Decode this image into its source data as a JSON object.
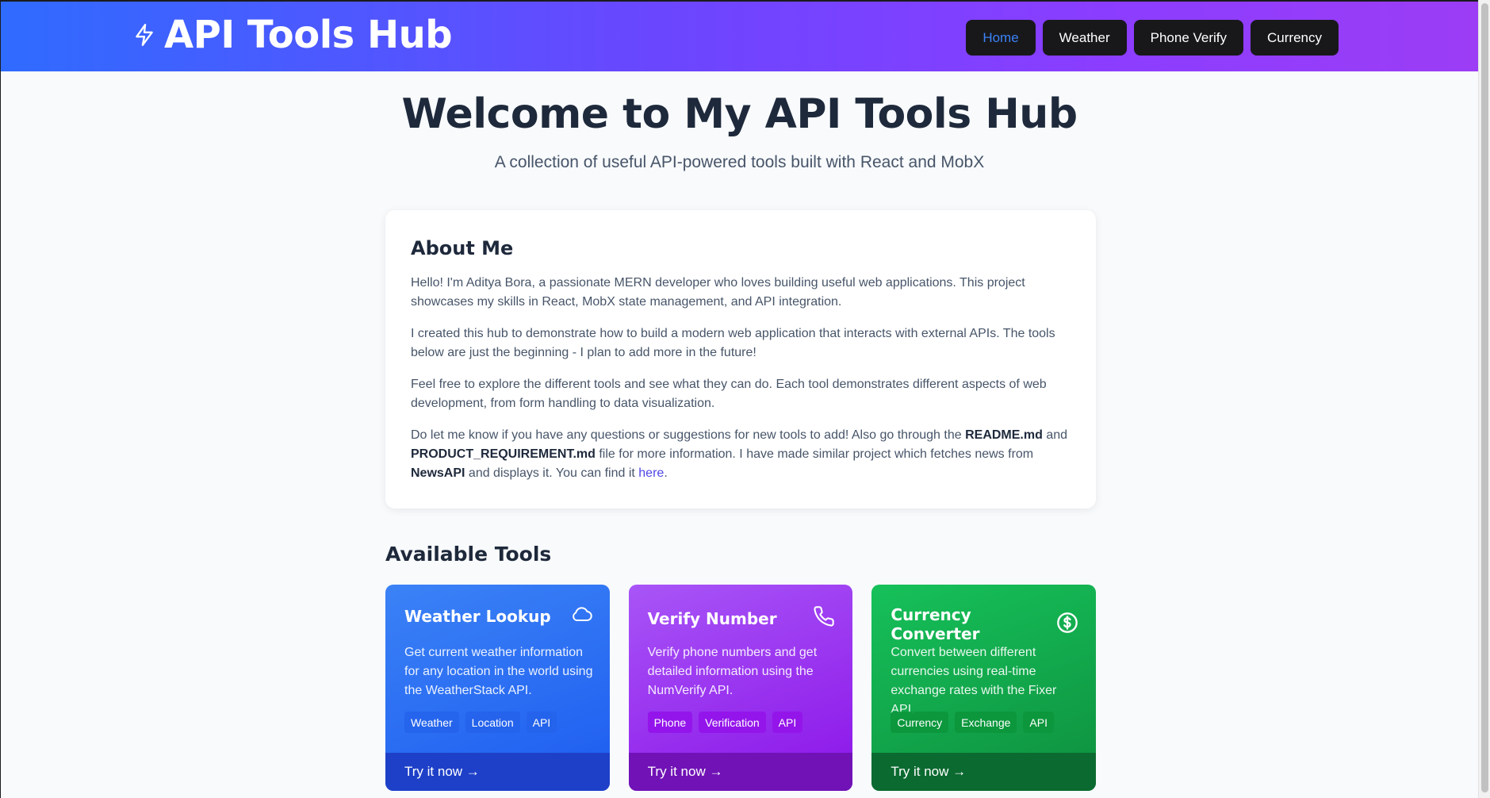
{
  "header": {
    "brand_title": "API Tools Hub",
    "brand_icon": "lightning-bolt-icon",
    "nav": [
      {
        "label": "Home",
        "active": true
      },
      {
        "label": "Weather",
        "active": false
      },
      {
        "label": "Phone Verify",
        "active": false
      },
      {
        "label": "Currency",
        "active": false
      }
    ],
    "gradient_colors": [
      "#2f6bff",
      "#9c3df5"
    ]
  },
  "hero": {
    "title": "Welcome to My API Tools Hub",
    "subtitle": "A collection of useful API-powered tools built with React and MobX"
  },
  "about": {
    "title": "About Me",
    "p1": "Hello! I'm Aditya Bora, a passionate MERN developer who loves building useful web applications. This project showcases my skills in React, MobX state management, and API integration.",
    "p2": "I created this hub to demonstrate how to build a modern web application that interacts with external APIs. The tools below are just the beginning - I plan to add more in the future!",
    "p3": "Feel free to explore the different tools and see what they can do. Each tool demonstrates different aspects of web development, from form handling to data visualization.",
    "p4": {
      "t1": "Do let me know if you have any questions or suggestions for new tools to add! Also go through the ",
      "b1": "README.md",
      "t2": " and ",
      "b2": "PRODUCT_REQUIREMENT.md",
      "t3": " file for more information. I have made similar project which fetches news from ",
      "b3": "NewsAPI",
      "t4": " and displays it. You can find it ",
      "link": "here",
      "t5": "."
    }
  },
  "tools_section": {
    "title": "Available Tools",
    "cards": [
      {
        "title": "Weather Lookup",
        "icon": "cloud-icon",
        "description": "Get current weather information for any location in the world using the WeatherStack API.",
        "tags": [
          "Weather",
          "Location",
          "API"
        ],
        "cta": "Try it now →",
        "color": "#2563eb"
      },
      {
        "title": "Verify Number",
        "icon": "phone-icon",
        "description": "Verify phone numbers and get detailed information using the NumVerify API.",
        "tags": [
          "Phone",
          "Verification",
          "API"
        ],
        "cta": "Try it now →",
        "color": "#9333ea"
      },
      {
        "title": "Currency Converter",
        "icon": "dollar-circle-icon",
        "description": "Convert between different currencies using real-time exchange rates with the Fixer API.",
        "tags": [
          "Currency",
          "Exchange",
          "API"
        ],
        "cta": "Try it now →",
        "color": "#16a34a"
      }
    ]
  }
}
